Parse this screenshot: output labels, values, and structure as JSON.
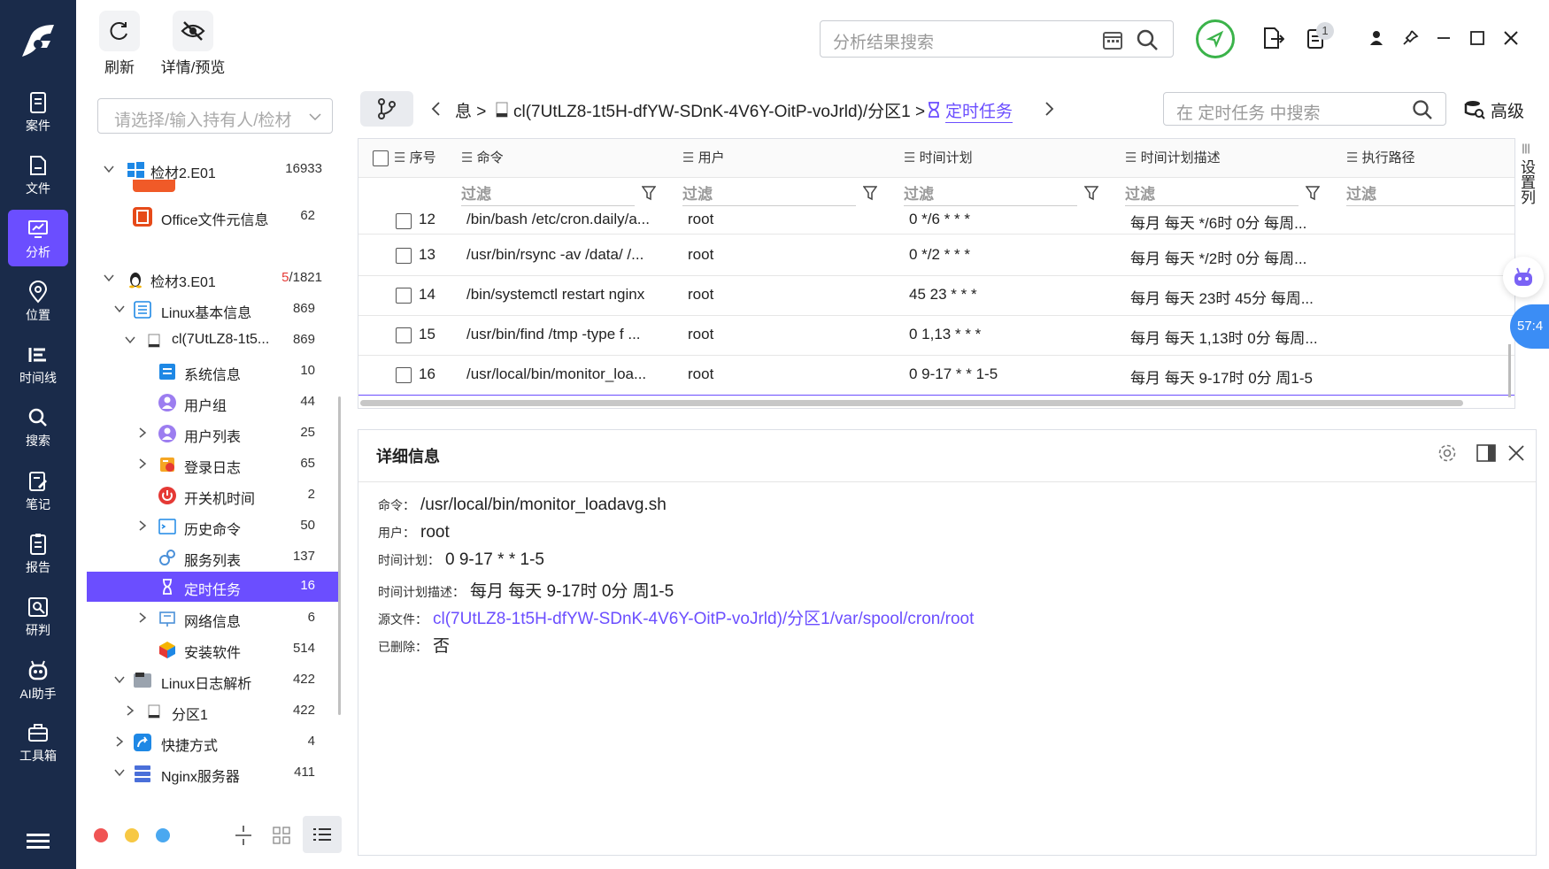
{
  "colors": {
    "accent": "#6b4eff",
    "nav_bg": "#1a2b4a"
  },
  "nav": {
    "items": [
      {
        "label": "案件",
        "icon": "case-icon"
      },
      {
        "label": "文件",
        "icon": "file-icon"
      },
      {
        "label": "分析",
        "icon": "analysis-icon",
        "active": true
      },
      {
        "label": "位置",
        "icon": "location-icon"
      },
      {
        "label": "时间线",
        "icon": "timeline-icon"
      },
      {
        "label": "搜索",
        "icon": "search-icon"
      },
      {
        "label": "笔记",
        "icon": "note-icon"
      },
      {
        "label": "报告",
        "icon": "report-icon"
      },
      {
        "label": "研判",
        "icon": "judge-icon"
      },
      {
        "label": "AI助手",
        "icon": "ai-assistant-icon"
      },
      {
        "label": "工具箱",
        "icon": "toolbox-icon"
      }
    ]
  },
  "toolbar": {
    "refresh_label": "刷新",
    "detail_label": "详情/预览"
  },
  "header": {
    "search_placeholder": "分析结果搜索",
    "badge": "1"
  },
  "left_panel": {
    "select_placeholder": "请选择/输入持有人/检材",
    "tree": [
      {
        "label": "检材2.E01",
        "count": "16933",
        "icon": "windows-icon"
      },
      {
        "label": "Office文件元信息",
        "count": "62",
        "icon": "office-icon"
      },
      {
        "label": "检材3.E01",
        "count_red": "5",
        "count_rest": "/1821",
        "icon": "linux-icon"
      },
      {
        "label": "Linux基本信息",
        "count": "869",
        "icon": "list-icon"
      },
      {
        "label": "cl(7UtLZ8-1t5...",
        "count": "869",
        "icon": "disk-icon"
      },
      {
        "label": "系统信息",
        "count": "10",
        "icon": "sysinfo-icon"
      },
      {
        "label": "用户组",
        "count": "44",
        "icon": "usergroup-icon"
      },
      {
        "label": "用户列表",
        "count": "25",
        "icon": "userlist-icon"
      },
      {
        "label": "登录日志",
        "count": "65",
        "icon": "login-log-icon"
      },
      {
        "label": "开关机时间",
        "count": "2",
        "icon": "power-icon"
      },
      {
        "label": "历史命令",
        "count": "50",
        "icon": "terminal-icon"
      },
      {
        "label": "服务列表",
        "count": "137",
        "icon": "service-icon"
      },
      {
        "label": "定时任务",
        "count": "16",
        "icon": "hourglass-icon",
        "selected": true
      },
      {
        "label": "网络信息",
        "count": "6",
        "icon": "network-icon"
      },
      {
        "label": "安装软件",
        "count": "514",
        "icon": "package-icon"
      },
      {
        "label": "Linux日志解析",
        "count": "422",
        "icon": "log-icon"
      },
      {
        "label": "分区1",
        "count": "422",
        "icon": "disk-icon"
      },
      {
        "label": "快捷方式",
        "count": "4",
        "icon": "shortcut-icon"
      },
      {
        "label": "Nginx服务器",
        "count": "411",
        "icon": "server-icon"
      }
    ]
  },
  "breadcrumb": {
    "part1": "息 >",
    "part2": "cl(7UtLZ8-1t5H-dfYW-SDnK-4V6Y-OitP-voJrld)/分区1 >",
    "current": "定时任务",
    "search_placeholder": "在 定时任务 中搜索",
    "advanced": "高级"
  },
  "table": {
    "columns": [
      "序号",
      "命令",
      "用户",
      "时间计划",
      "时间计划描述",
      "执行路径"
    ],
    "filter_placeholder": "过滤",
    "rows": [
      [
        "12",
        "/bin/bash /etc/cron.daily/a...",
        "root",
        "0 */6 * * *",
        "每月 每天 */6时 0分 每周..."
      ],
      [
        "13",
        "/usr/bin/rsync -av /data/ /...",
        "root",
        "0 */2 * * *",
        "每月 每天 */2时 0分 每周..."
      ],
      [
        "14",
        "/bin/systemctl restart nginx",
        "root",
        "45 23 * * *",
        "每月 每天 23时 45分 每周..."
      ],
      [
        "15",
        "/usr/bin/find /tmp -type f ...",
        "root",
        "0 1,13 * * *",
        "每月 每天 1,13时 0分 每周..."
      ],
      [
        "16",
        "/usr/local/bin/monitor_loa...",
        "root",
        "0 9-17 * * 1-5",
        "每月 每天 9-17时 0分 周1-5"
      ]
    ],
    "side_tab": "设置列"
  },
  "detail": {
    "title": "详细信息",
    "fields": [
      {
        "k": "命令：",
        "v": "/usr/local/bin/monitor_loadavg.sh"
      },
      {
        "k": "用户：",
        "v": "root"
      },
      {
        "k": "时间计划：",
        "v": "0 9-17 * * 1-5"
      },
      {
        "k": "时间计划描述：",
        "v": "每月 每天 9-17时 0分 周1-5"
      },
      {
        "k": "源文件：",
        "v": "cl(7UtLZ8-1t5H-dfYW-SDnK-4V6Y-OitP-voJrld)/分区1/var/spool/cron/root"
      },
      {
        "k": "已删除：",
        "v": "否"
      }
    ]
  },
  "floating": {
    "timer": "57:4"
  }
}
